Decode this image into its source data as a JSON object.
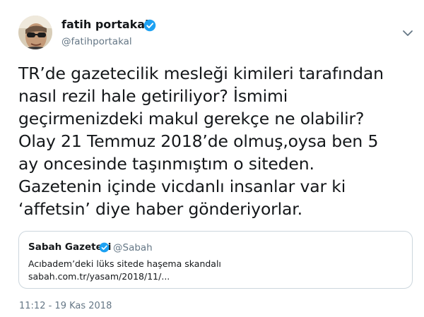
{
  "author": {
    "name": "fatih portakal",
    "handle": "@fatihportakal",
    "verified": true,
    "avatar_icon": "profile-photo"
  },
  "menu_icon": "chevron-down-icon",
  "tweet": {
    "lines": [
      "TR’de gazetecilik mesleği kimileri tarafından",
      "nasıl rezil hale getiriliyor? İsmimi",
      "geçirmenizdeki makul gerekçe ne olabilir?",
      "Olay 21 Temmuz 2018’de olmuş,oysa ben 5",
      "ay oncesinde taşınmıştım o siteden.",
      "Gazetenin içinde vicdanlı insanlar var ki",
      "‘affetsin’ diye haber gönderiyorlar."
    ]
  },
  "quoted": {
    "name": "Sabah Gazetesi",
    "handle": "@Sabah",
    "verified": true,
    "lines": [
      "Acıbadem’deki lüks sitede haşema skandalı",
      "sabah.com.tr/yasam/2018/11/..."
    ]
  },
  "timestamp": "11:12 - 19 Kas 2018",
  "colors": {
    "text": "#14171a",
    "secondary": "#657786",
    "verified": "#1da1f2",
    "border": "#ccd6dd"
  }
}
